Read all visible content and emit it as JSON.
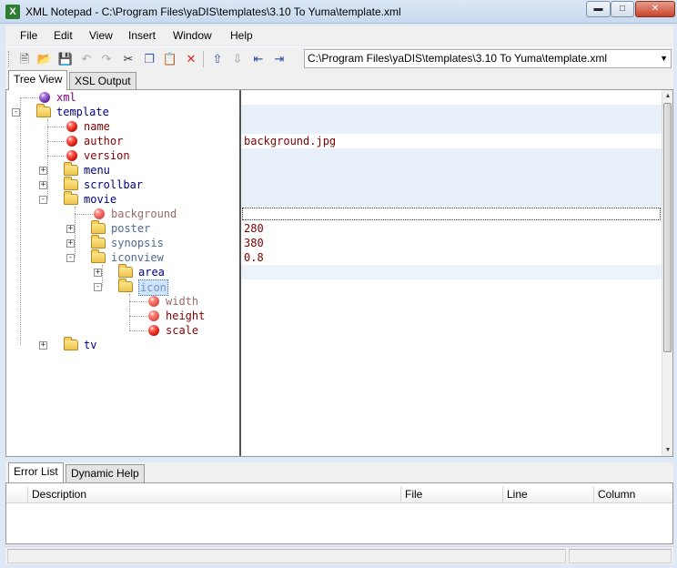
{
  "window": {
    "title": "XML Notepad - C:\\Program Files\\yaDIS\\templates\\3.10 To Yuma\\template.xml",
    "app_icon": "X"
  },
  "menu": [
    "File",
    "Edit",
    "View",
    "Insert",
    "Window",
    "Help"
  ],
  "toolbar": {
    "path_value": "C:\\Program Files\\yaDIS\\templates\\3.10 To Yuma\\template.xml"
  },
  "tabs": {
    "tree_view": "Tree View",
    "xsl_output": "XSL Output"
  },
  "tree": {
    "xml": "xml",
    "template": "template",
    "name": "name",
    "author": "author",
    "version": "version",
    "menu": "menu",
    "scrollbar": "scrollbar",
    "movie": "movie",
    "background": "background",
    "poster": "poster",
    "synopsis": "synopsis",
    "iconview": "iconview",
    "area": "area",
    "icon": "icon",
    "width": "width",
    "height": "height",
    "scale": "scale",
    "tv": "tv"
  },
  "values": {
    "author": "background.jpg",
    "poster": "280",
    "synopsis": "380",
    "iconview": "0.8"
  },
  "bottom_tabs": {
    "error_list": "Error List",
    "dynamic_help": "Dynamic Help"
  },
  "error_columns": {
    "description": "Description",
    "file": "File",
    "line": "Line",
    "column": "Column"
  },
  "colors": {
    "attribute": "#800000",
    "element": "#000080",
    "selection": "#cfe4fb"
  }
}
